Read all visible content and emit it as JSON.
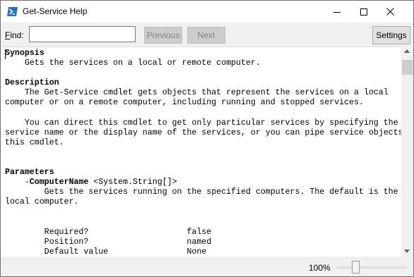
{
  "window": {
    "title": "Get-Service Help"
  },
  "icons": {
    "app": "powershell-icon",
    "minimize": "minimize-icon",
    "maximize": "maximize-icon",
    "close": "close-icon"
  },
  "toolbar": {
    "find_label_underlined": "F",
    "find_label_rest": "ind:",
    "find_value": "",
    "previous_label": "Previous",
    "next_label": "Next",
    "settings_label": "Settings"
  },
  "help": {
    "synopsis_heading": "Synopsis",
    "synopsis_text": "    Gets the services on a local or remote computer.",
    "description_heading": "Description",
    "description_p1": "    The Get-Service cmdlet gets objects that represent the services on a local\ncomputer or on a remote computer, including running and stopped services.",
    "description_p2": "    You can direct this cmdlet to get only particular services by specifying the\nservice name or the display name of the services, or you can pipe service objects to\nthis cmdlet.",
    "parameters_heading": "Parameters",
    "param_indent": "    -",
    "param_name": "ComputerName",
    "param_type": " <System.String[]>",
    "param_desc": "        Gets the services running on the specified computers. The default is the\nlocal computer.",
    "param_props": "        Required?                    false\n        Position?                    named\n        Default value                None"
  },
  "status": {
    "zoom": "100%"
  },
  "colors": {
    "window_bg": "#f0f0f0",
    "content_bg": "#ffffff",
    "disabled_text": "#838383"
  }
}
